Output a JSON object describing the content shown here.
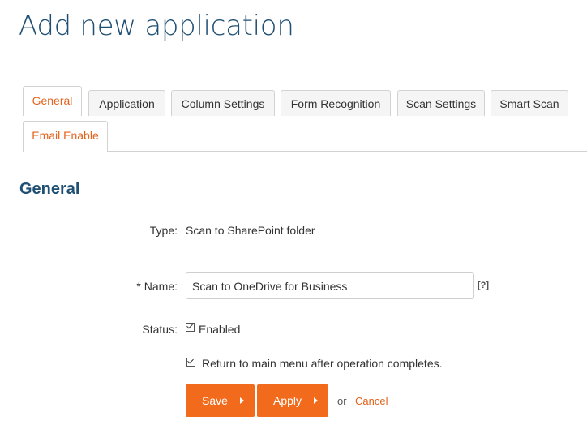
{
  "page": {
    "title": "Add new application"
  },
  "tabs": [
    {
      "label": "General",
      "active": true
    },
    {
      "label": "Application",
      "active": false
    },
    {
      "label": "Column Settings",
      "active": false
    },
    {
      "label": "Form Recognition",
      "active": false
    },
    {
      "label": "Scan Settings",
      "active": false
    },
    {
      "label": "Smart Scan",
      "active": false
    },
    {
      "label": "Email Enable",
      "active": false
    }
  ],
  "section": {
    "heading": "General"
  },
  "form": {
    "type_label": "Type:",
    "type_value": "Scan to SharePoint folder",
    "name_label": "* Name:",
    "name_value": "Scan to OneDrive for Business",
    "help_link": "[?]",
    "status_label": "Status:",
    "status_checkbox_label": "Enabled",
    "status_checked": true,
    "return_checkbox_label": "Return to main menu after operation completes.",
    "return_checked": true
  },
  "actions": {
    "save_label": "Save",
    "apply_label": "Apply",
    "or_text": "or",
    "cancel_label": "Cancel"
  },
  "colors": {
    "accent": "#f26b1d",
    "heading": "#1f4f73",
    "active_tab_text": "#e2631d"
  }
}
